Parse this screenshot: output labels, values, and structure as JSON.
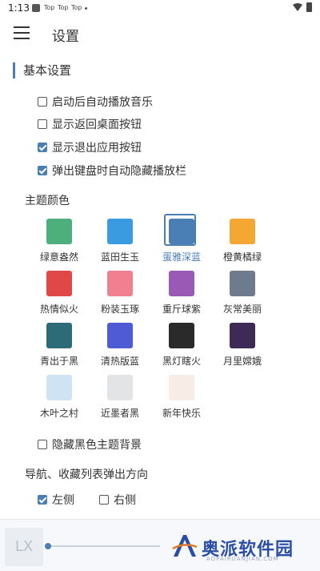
{
  "status": {
    "time": "1:13",
    "notifications": [
      "Top",
      "Top",
      "Top"
    ]
  },
  "header": {
    "title": "设置"
  },
  "basic": {
    "title": "基本设置",
    "options": [
      {
        "label": "启动后自动播放音乐",
        "checked": false
      },
      {
        "label": "显示返回桌面按钮",
        "checked": false
      },
      {
        "label": "显示退出应用按钮",
        "checked": true
      },
      {
        "label": "弹出键盘时自动隐藏播放栏",
        "checked": true
      }
    ]
  },
  "theme": {
    "title": "主题颜色",
    "selected": "蛋雅深蓝",
    "items": [
      {
        "name": "绿意盎然",
        "color": "#4caf7c"
      },
      {
        "name": "蓝田生玉",
        "color": "#3a9be0"
      },
      {
        "name": "蛋雅深蓝",
        "color": "#4a7fb5"
      },
      {
        "name": "橙黄橘绿",
        "color": "#f5a733"
      },
      {
        "name": "热情似火",
        "color": "#e04848"
      },
      {
        "name": "粉装玉琢",
        "color": "#f0808f"
      },
      {
        "name": "重斤球紫",
        "color": "#9b59b6"
      },
      {
        "name": "灰常美丽",
        "color": "#6d7b8d"
      },
      {
        "name": "青出于黑",
        "color": "#2e6b78"
      },
      {
        "name": "清热版蓝",
        "color": "#4f5bd5"
      },
      {
        "name": "黑灯瞎火",
        "color": "#2a2a2a"
      },
      {
        "name": "月里嫦娥",
        "color": "#3d2a55"
      },
      {
        "name": "木叶之村",
        "color": "#cfe3f2"
      },
      {
        "name": "近墨者黑",
        "color": "#e2e4e6"
      },
      {
        "name": "新年快乐",
        "color": "#f7ece6"
      }
    ]
  },
  "hide_dark_bg": {
    "label": "隐藏黑色主题背景",
    "checked": false
  },
  "popup": {
    "title": "导航、收藏列表弹出方向",
    "left": {
      "label": "左侧",
      "checked": true
    },
    "right": {
      "label": "右侧",
      "checked": false
    }
  },
  "player": {
    "cover_text": "LX",
    "progress": 0
  },
  "watermark": {
    "text": "奥派软件园",
    "sub": "AOPAIRUANJIAN.COM"
  }
}
